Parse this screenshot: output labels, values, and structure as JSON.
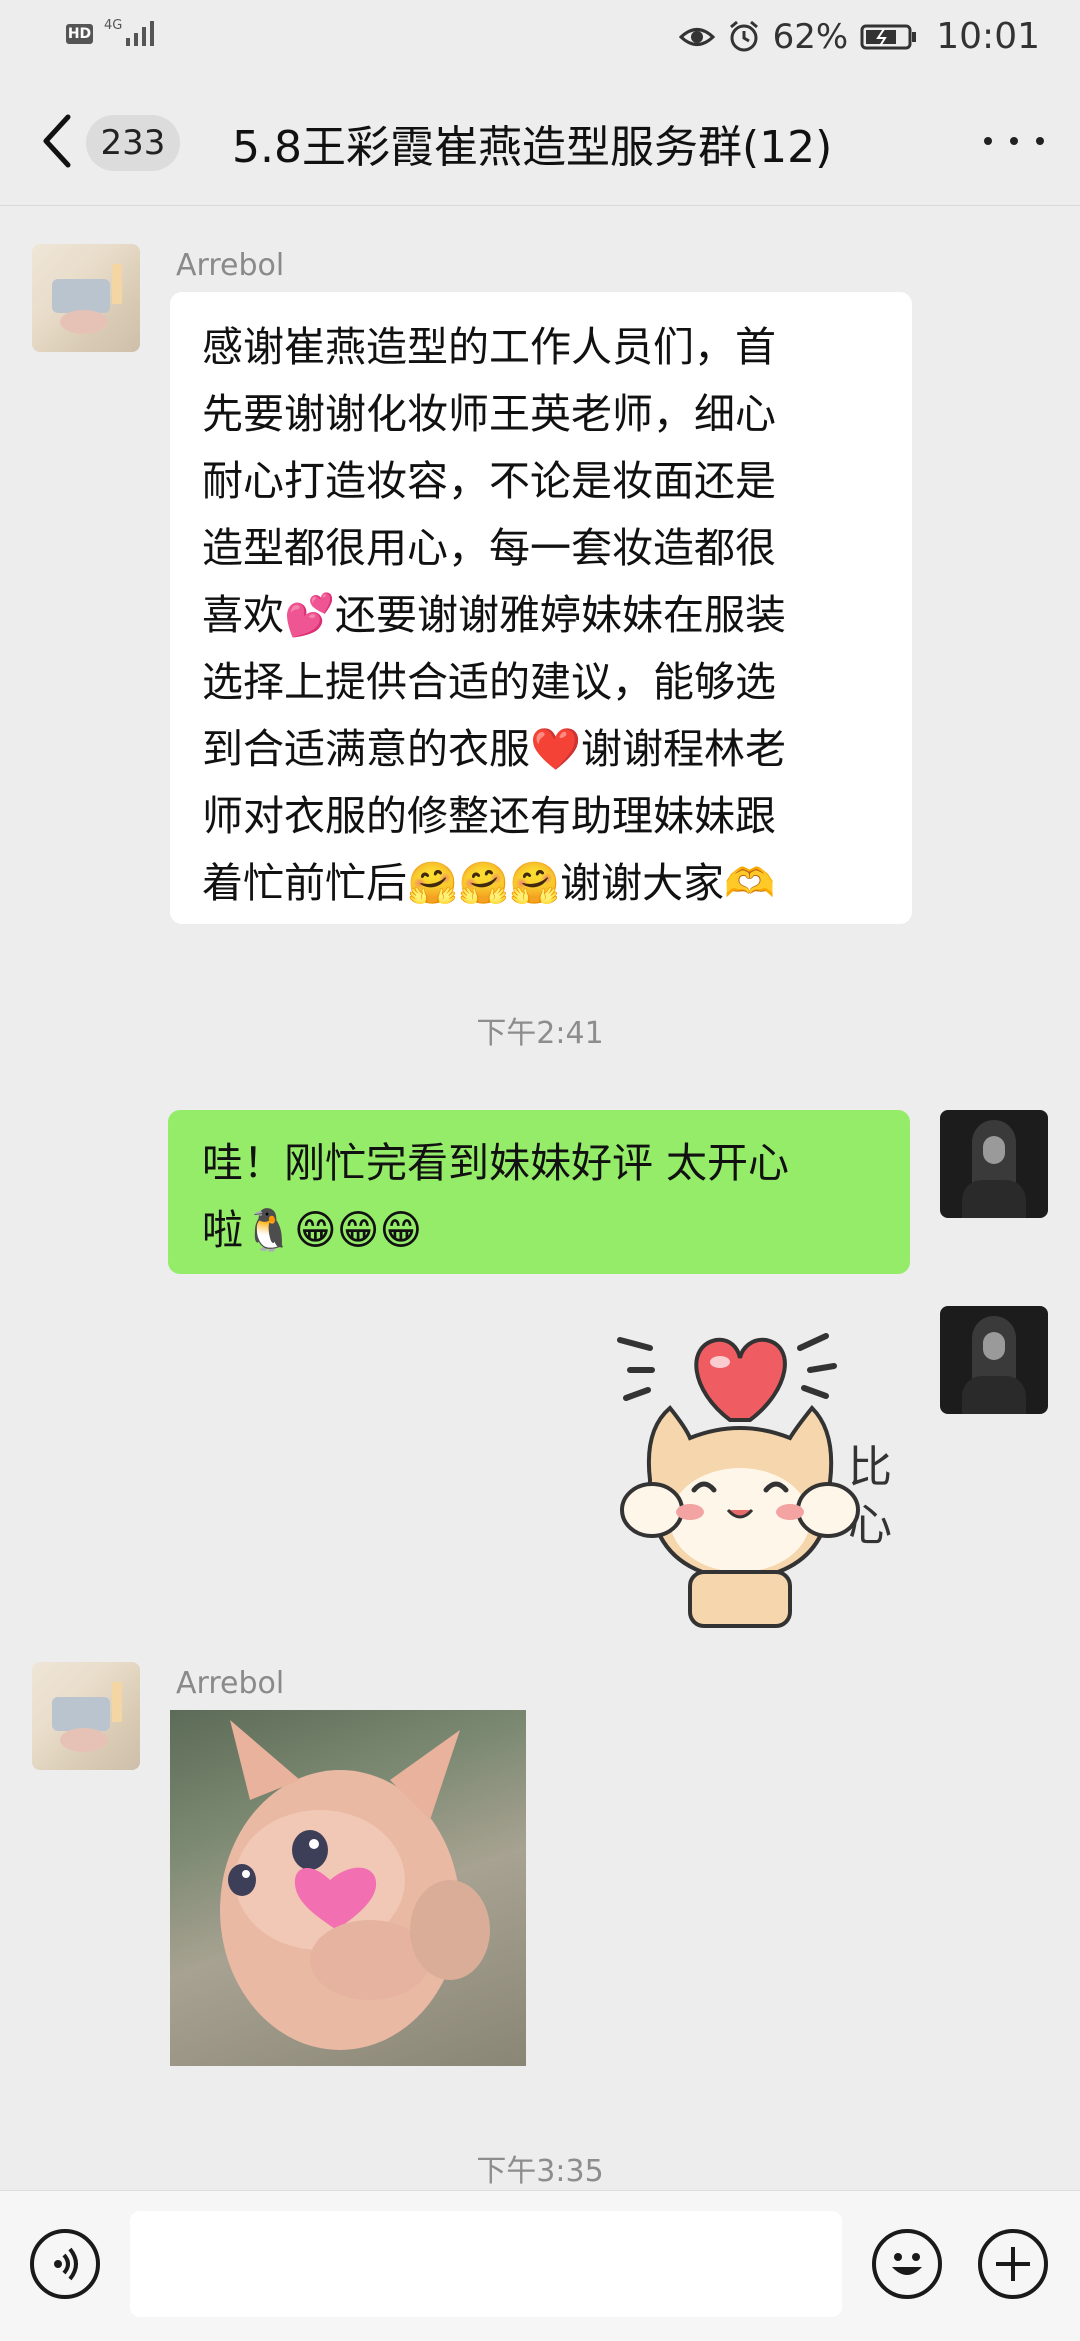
{
  "status_bar": {
    "hd": "HD",
    "network": "4G",
    "battery_percent": "62%",
    "time": "10:01"
  },
  "header": {
    "unread_count": "233",
    "title": "5.8王彩霞崔燕造型服务群(12)"
  },
  "messages": [
    {
      "sender": "Arrebol",
      "lines": [
        "感谢崔燕造型的工作人员们，首",
        "先要谢谢化妆师王英老师，细心",
        "耐心打造妆容，不论是妆面还是",
        "造型都很用心，每一套妆造都很",
        "喜欢💕还要谢谢雅婷妹妹在服装",
        "选择上提供合适的建议，能够选",
        "到合适满意的衣服❤️谢谢程林老",
        "师对衣服的修整还有助理妹妹跟",
        "着忙前忙后🤗🤗🤗谢谢大家🫶"
      ]
    },
    {
      "time": "下午2:41"
    },
    {
      "sender": "me",
      "lines": [
        "哇！刚忙完看到妹妹好评  太开心",
        "啦🐧😁😁😁"
      ]
    },
    {
      "sender": "me",
      "sticker_text": "比心"
    },
    {
      "sender": "Arrebol",
      "image": "plush-toy-photo"
    },
    {
      "time": "下午3:35"
    }
  ],
  "input_bar": {
    "voice_icon": "voice-icon",
    "emoji_icon": "emoji-icon",
    "add_icon": "plus-icon"
  },
  "colors": {
    "background": "#ededed",
    "my_bubble": "#95ec69",
    "other_bubble": "#ffffff"
  }
}
